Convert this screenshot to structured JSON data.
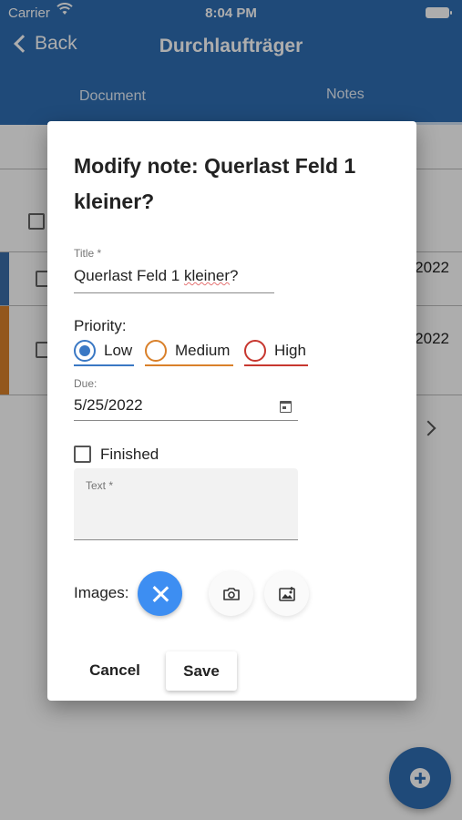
{
  "status_bar": {
    "carrier": "Carrier",
    "time": "8:04 PM"
  },
  "nav": {
    "back_label": "Back",
    "title": "Durchlaufträger"
  },
  "tabs": [
    {
      "label": "Document"
    },
    {
      "label": "Notes"
    }
  ],
  "background_list": {
    "rows": [
      {
        "date_fragment": "2022",
        "stripe_color": "#3a6ea8"
      },
      {
        "date_fragment": "2022",
        "stripe_color": "#d9802a"
      }
    ]
  },
  "dialog": {
    "title": "Modify note: Querlast Feld 1 kleiner?",
    "title_field": {
      "label": "Title *",
      "value_prefix": "Querlast Feld 1 ",
      "value_misspelled": "kleiner",
      "value_suffix": "?"
    },
    "priority": {
      "label": "Priority:",
      "options": [
        {
          "label": "Low",
          "color": "#3a78c4",
          "selected": true
        },
        {
          "label": "Medium",
          "color": "#d9802a",
          "selected": false
        },
        {
          "label": "High",
          "color": "#c7372f",
          "selected": false
        }
      ]
    },
    "due": {
      "label": "Due:",
      "value": "5/25/2022"
    },
    "finished": {
      "label": "Finished",
      "checked": false
    },
    "text_field": {
      "label": "Text *",
      "value": ""
    },
    "images": {
      "label": "Images:"
    },
    "buttons": {
      "cancel": "Cancel",
      "save": "Save"
    }
  },
  "colors": {
    "primary": "#2f6db3",
    "accent_fab": "#3d8ef2"
  },
  "icons": [
    "wifi-icon",
    "battery-icon",
    "back-chevron-icon",
    "calendar-icon",
    "clear-icon",
    "camera-icon",
    "gallery-icon",
    "add-icon",
    "chevron-right-icon"
  ]
}
